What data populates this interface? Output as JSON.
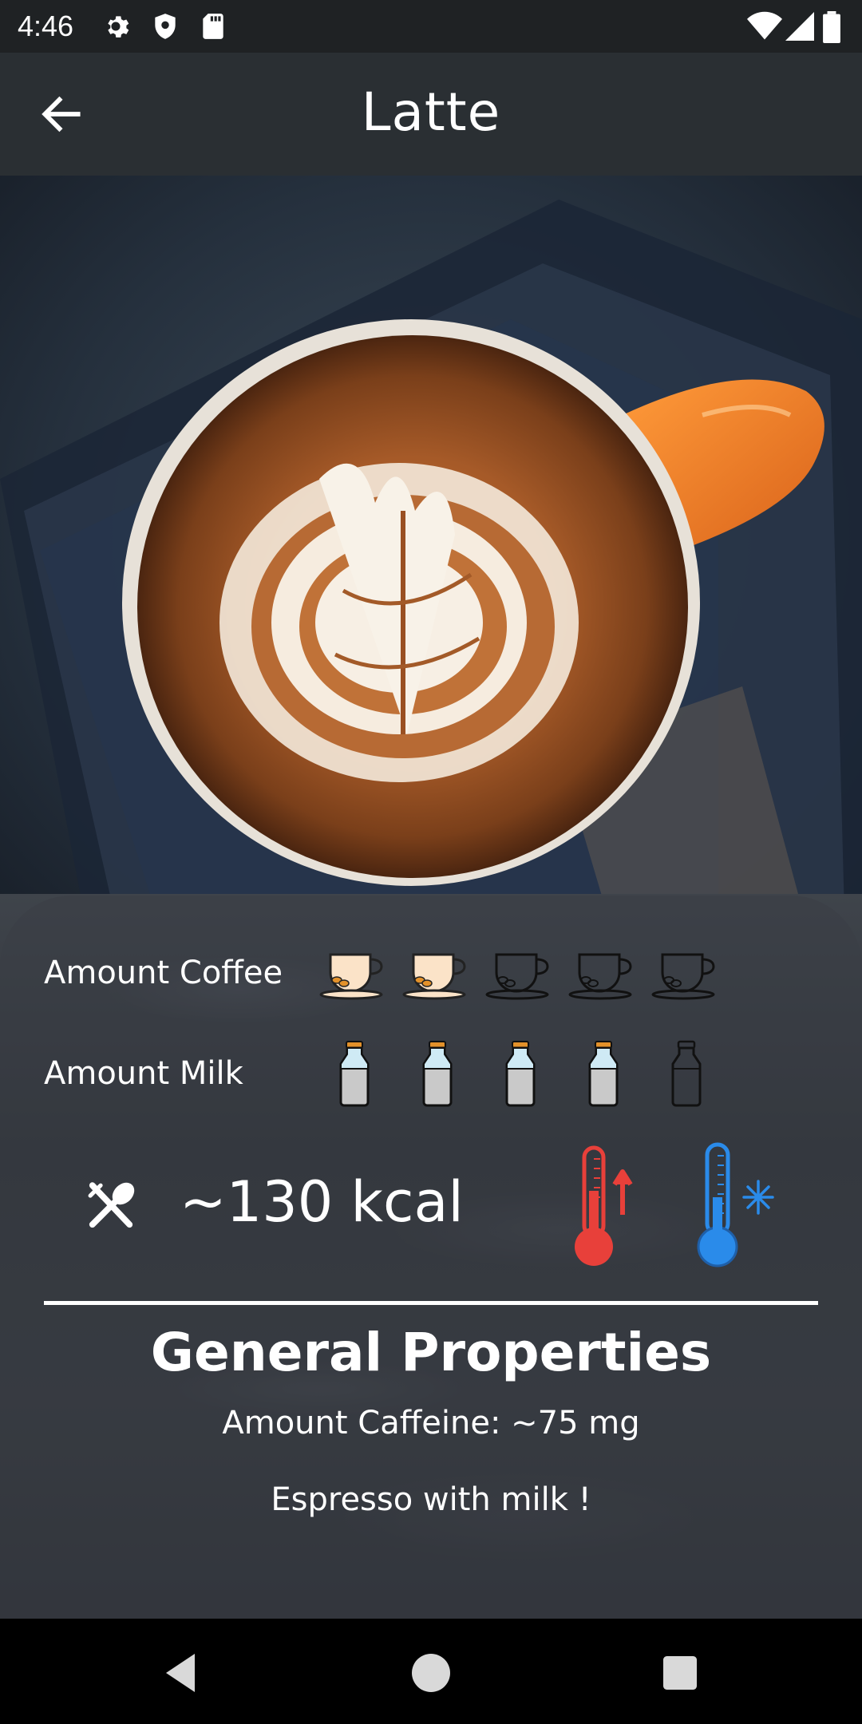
{
  "status_bar": {
    "time": "4:46",
    "icons": [
      "gear-icon",
      "shield-icon",
      "sd-card-icon",
      "wifi-icon",
      "signal-icon",
      "battery-icon"
    ]
  },
  "app_bar": {
    "title": "Latte",
    "back_icon": "arrow-left-icon"
  },
  "details": {
    "coffee_label": "Amount Coffee",
    "coffee_level": 2,
    "coffee_max": 5,
    "milk_label": "Amount Milk",
    "milk_level": 4,
    "milk_max": 5,
    "calories": "~130 kcal",
    "temperature_options": [
      "hot",
      "cold"
    ]
  },
  "general": {
    "title": "General Properties",
    "caffeine": "Amount Caffeine: ~75 mg",
    "description": "Espresso with milk !"
  },
  "colors": {
    "hot": "#e8403a",
    "cold": "#2a8bea",
    "cup_fill": "#fbe3c8",
    "bean": "#e3912a",
    "milk_fill": "#c9c9c9",
    "milk_cap": "#e3912a"
  }
}
